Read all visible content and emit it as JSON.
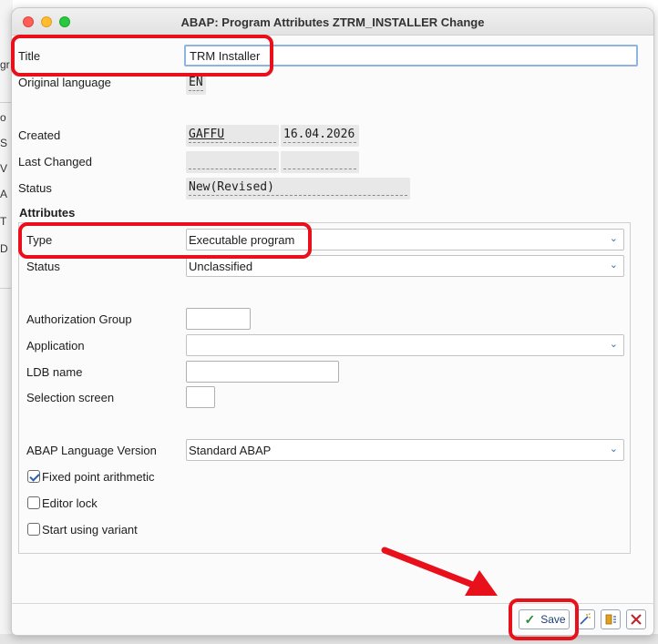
{
  "window": {
    "title": "ABAP: Program Attributes ZTRM_INSTALLER Change"
  },
  "background": {
    "fragments": [
      "gr",
      "o",
      "S",
      "V",
      "A",
      "T",
      "D"
    ]
  },
  "header_fields": {
    "title_label": "Title",
    "title_value": "TRM Installer",
    "original_language_label": "Original language",
    "original_language_value": "EN",
    "created_label": "Created",
    "created_user": "GAFFU",
    "created_date": "16.04.2026",
    "last_changed_label": "Last Changed",
    "last_changed_user": "",
    "last_changed_date": "",
    "status_label": "Status",
    "status_value": "New(Revised)"
  },
  "attributes": {
    "section_title": "Attributes",
    "type_label": "Type",
    "type_value": "Executable program",
    "status_label": "Status",
    "status_value": "Unclassified",
    "auth_group_label": "Authorization Group",
    "auth_group_value": "",
    "application_label": "Application",
    "application_value": "",
    "ldb_label": "LDB name",
    "ldb_value": "",
    "selection_screen_label": "Selection screen",
    "selection_screen_value": "",
    "abap_version_label": "ABAP Language Version",
    "abap_version_value": "Standard ABAP",
    "checkboxes": [
      {
        "label": "Fixed point arithmetic",
        "checked": true
      },
      {
        "label": "Editor lock",
        "checked": false
      },
      {
        "label": "Start using variant",
        "checked": false
      }
    ]
  },
  "footer": {
    "save_label": "Save",
    "icons": [
      "wand-icon",
      "clipboard-icon",
      "cancel-icon"
    ]
  },
  "colors": {
    "annotation": "#e8101b",
    "accent": "#3a6db5",
    "save_check": "#2b8a3e"
  }
}
